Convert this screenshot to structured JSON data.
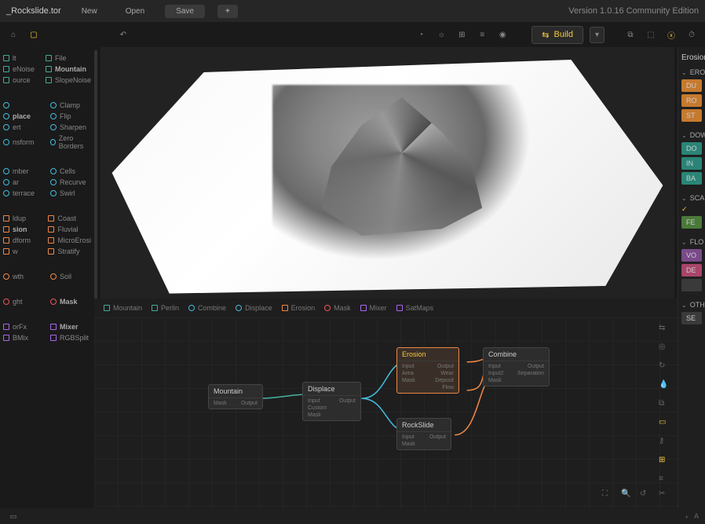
{
  "header": {
    "filename": "_Rockslide.tor",
    "new": "New",
    "open": "Open",
    "save": "Save",
    "plus": "+",
    "version": "Version 1.0.16 Community Edition"
  },
  "toolbar": {
    "build": "Build"
  },
  "sidebar": {
    "group1": [
      {
        "label": "lt",
        "color": "green",
        "shape": "sq"
      },
      {
        "label": "File",
        "color": "green",
        "shape": "sq"
      },
      {
        "label": "eNoise",
        "color": "green",
        "shape": "sq"
      },
      {
        "label": "Mountain",
        "color": "green",
        "shape": "sq",
        "bold": true
      },
      {
        "label": "ource",
        "color": "green",
        "shape": "sq"
      },
      {
        "label": "SlopeNoise",
        "color": "green",
        "shape": "sq"
      }
    ],
    "group2": [
      {
        "label": "",
        "color": "cyan",
        "shape": "ci"
      },
      {
        "label": "Clamp",
        "color": "cyan",
        "shape": "ci"
      },
      {
        "label": "place",
        "color": "cyan",
        "shape": "ci",
        "bold": true
      },
      {
        "label": "Flip",
        "color": "cyan",
        "shape": "ci"
      },
      {
        "label": "ert",
        "color": "cyan",
        "shape": "ci"
      },
      {
        "label": "Sharpen",
        "color": "cyan",
        "shape": "ci"
      },
      {
        "label": "nsform",
        "color": "cyan",
        "shape": "ci"
      },
      {
        "label": "Zero Borders",
        "color": "cyan",
        "shape": "ci"
      }
    ],
    "group3": [
      {
        "label": "mber",
        "color": "cyan",
        "shape": "ci"
      },
      {
        "label": "Cells",
        "color": "cyan",
        "shape": "ci"
      },
      {
        "label": "ar",
        "color": "cyan",
        "shape": "ci"
      },
      {
        "label": "Recurve",
        "color": "cyan",
        "shape": "ci"
      },
      {
        "label": "terrace",
        "color": "cyan",
        "shape": "ci"
      },
      {
        "label": "Swirl",
        "color": "cyan",
        "shape": "ci"
      }
    ],
    "group4": [
      {
        "label": "ldup",
        "color": "orange",
        "shape": "sq"
      },
      {
        "label": "Coast",
        "color": "orange",
        "shape": "sq"
      },
      {
        "label": "sion",
        "color": "orange",
        "shape": "sq",
        "bold": true
      },
      {
        "label": "Fluvial",
        "color": "orange",
        "shape": "sq"
      },
      {
        "label": "dform",
        "color": "orange",
        "shape": "sq"
      },
      {
        "label": "MicroErosi",
        "color": "orange",
        "shape": "sq"
      },
      {
        "label": "w",
        "color": "orange",
        "shape": "sq"
      },
      {
        "label": "Stratify",
        "color": "orange",
        "shape": "sq"
      }
    ],
    "group5": [
      {
        "label": "wth",
        "color": "orange",
        "shape": "ci"
      },
      {
        "label": "Soil",
        "color": "orange",
        "shape": "ci"
      }
    ],
    "group6": [
      {
        "label": "ght",
        "color": "red",
        "shape": "ci"
      },
      {
        "label": "Mask",
        "color": "red",
        "shape": "ci",
        "bold": true
      }
    ],
    "group7": [
      {
        "label": "orFx",
        "color": "purple",
        "shape": "sq"
      },
      {
        "label": "Mixer",
        "color": "purple",
        "shape": "sq",
        "bold": true
      },
      {
        "label": "BMix",
        "color": "purple",
        "shape": "sq"
      },
      {
        "label": "RGBSplit",
        "color": "purple",
        "shape": "sq"
      }
    ]
  },
  "nodebar": [
    {
      "label": "Mountain",
      "color": "green",
      "shape": "sq"
    },
    {
      "label": "Perlin",
      "color": "green",
      "shape": "sq"
    },
    {
      "label": "Combine",
      "color": "cyan",
      "shape": "ci"
    },
    {
      "label": "Displace",
      "color": "cyan",
      "shape": "ci"
    },
    {
      "label": "Erosion",
      "color": "orange",
      "shape": "sq"
    },
    {
      "label": "Mask",
      "color": "red",
      "shape": "ci"
    },
    {
      "label": "Mixer",
      "color": "purple",
      "shape": "sq"
    },
    {
      "label": "SatMaps",
      "color": "purple",
      "shape": "sq"
    }
  ],
  "graph": {
    "mountain": {
      "title": "Mountain",
      "ports": {
        "mask": "Mask",
        "output": "Output"
      }
    },
    "displace": {
      "title": "Displace",
      "ports": {
        "input": "Input",
        "custom": "Custom",
        "mask": "Mask",
        "output": "Output"
      }
    },
    "erosion": {
      "title": "Erosion",
      "ports": {
        "input": "Input",
        "area": "Area",
        "mask": "Mask",
        "output": "Output",
        "wear": "Wear",
        "deposit": "Deposit",
        "flow": "Flow"
      }
    },
    "rockslide": {
      "title": "RockSlide",
      "ports": {
        "input": "Input",
        "mask": "Mask",
        "output": "Output"
      }
    },
    "combine": {
      "title": "Combine",
      "ports": {
        "input": "Input",
        "input2": "Input2",
        "mask": "Mask",
        "output": "Output",
        "separation": "Separation"
      }
    }
  },
  "right": {
    "title": "Erosion",
    "sec1": {
      "head": "ERO",
      "btns": [
        "DU",
        "RO",
        "ST"
      ]
    },
    "sec2": {
      "head": "DOW",
      "btns": [
        "DO",
        "IN",
        "BA"
      ]
    },
    "sec3": {
      "head": "SCA",
      "check": "",
      "btns": [
        "FE"
      ]
    },
    "sec4": {
      "head": "FLO",
      "btns": [
        "VO",
        "DE"
      ]
    },
    "sec5": {
      "head": "OTH",
      "btns": [
        "SE"
      ]
    }
  }
}
